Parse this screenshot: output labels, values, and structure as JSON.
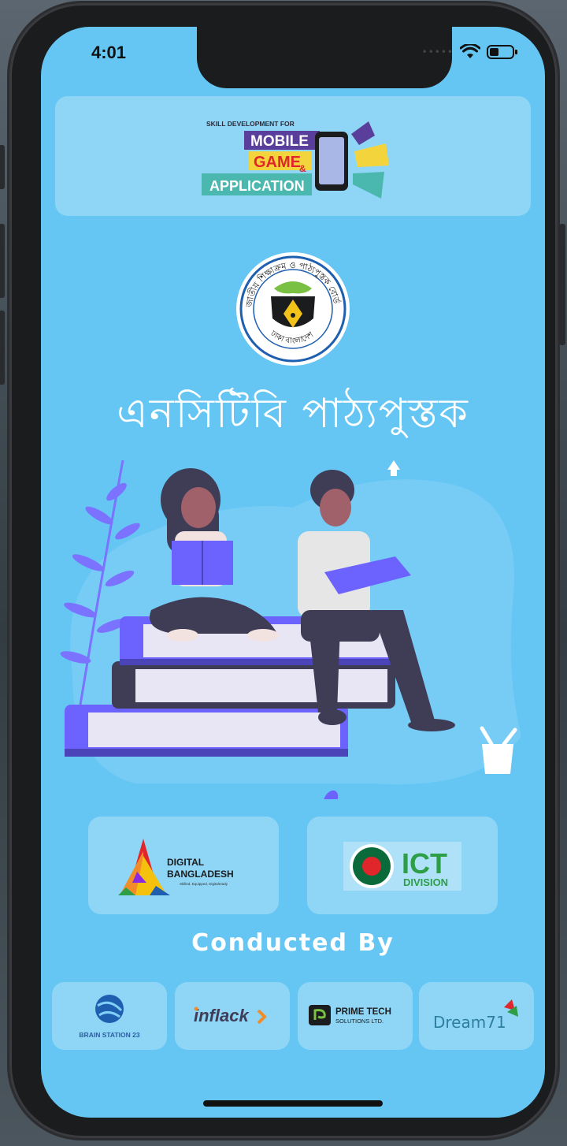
{
  "status_bar": {
    "time": "4:01"
  },
  "banner": {
    "tagline": "SKILL DEVELOPMENT FOR",
    "line1": "MOBILE",
    "line2": "GAME",
    "amp": "&",
    "line3": "APPLICATION"
  },
  "emblem": {
    "top_text": "জাতীয় শিক্ষাক্রম ও পাঠ্যপুস্তক বোর্ড",
    "bottom_text": "ঢাকা বাংলাদেশ"
  },
  "headline": "এনসিটিবি পাঠ্যপুস্তক",
  "partners": {
    "digital_bangladesh": {
      "line1": "DIGITAL",
      "line2": "BANGLADESH",
      "tagline": "Skilled, Equipped, Digitalready"
    },
    "ict": {
      "title": "ICT",
      "subtitle": "DIVISION"
    }
  },
  "conducted_by": "Conducted By",
  "sponsors": {
    "brain_station": "BRAIN STATION 23",
    "inflack": "inflack",
    "prime_tech_line1": "PRIME TECH",
    "prime_tech_line2": "SOLUTIONS LTD.",
    "dream71": "Dream71"
  },
  "colors": {
    "screen_bg": "#65c6f3",
    "card_bg": "rgba(255,255,255,0.28)",
    "book_purple": "#6c63ff",
    "ict_green": "#2e9e47",
    "bd_flag_green": "#0a6a3a",
    "bd_flag_red": "#e0262a"
  }
}
